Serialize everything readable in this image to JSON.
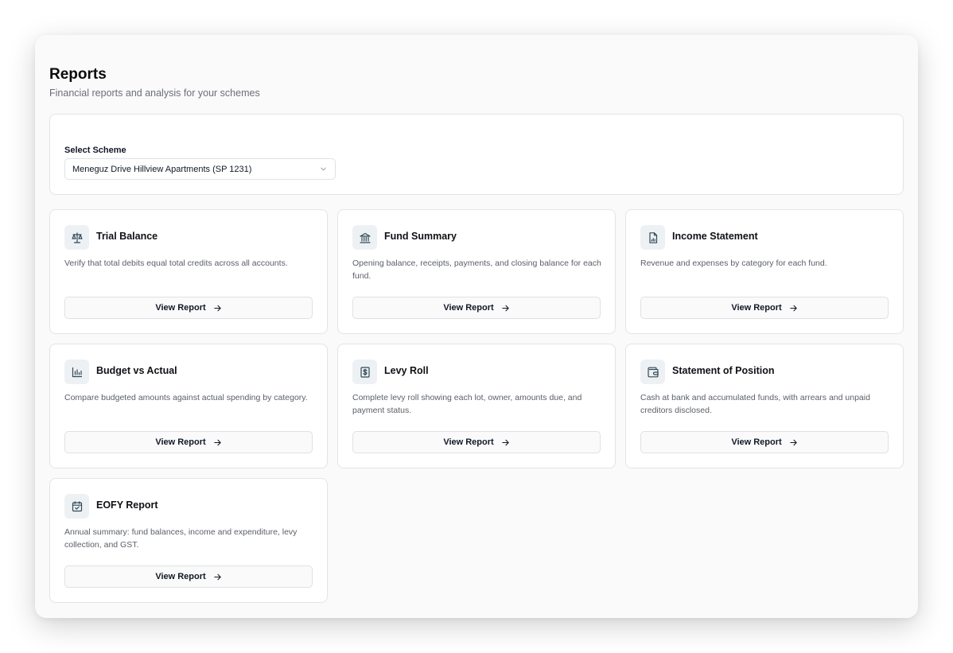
{
  "page": {
    "title": "Reports",
    "subtitle": "Financial reports and analysis for your schemes"
  },
  "scheme": {
    "label": "Select Scheme",
    "selected": "Meneguz Drive Hillview Apartments (SP 1231)"
  },
  "reports": [
    {
      "icon": "scale-icon",
      "title": "Trial Balance",
      "description": "Verify that total debits equal total credits across all accounts.",
      "button": "View Report"
    },
    {
      "icon": "bank-icon",
      "title": "Fund Summary",
      "description": "Opening balance, receipts, payments, and closing balance for each fund.",
      "button": "View Report"
    },
    {
      "icon": "document-chart-icon",
      "title": "Income Statement",
      "description": "Revenue and expenses by category for each fund.",
      "button": "View Report"
    },
    {
      "icon": "bar-chart-icon",
      "title": "Budget vs Actual",
      "description": "Compare budgeted amounts against actual spending by category.",
      "button": "View Report"
    },
    {
      "icon": "dollar-receipt-icon",
      "title": "Levy Roll",
      "description": "Complete levy roll showing each lot, owner, amounts due, and payment status.",
      "button": "View Report"
    },
    {
      "icon": "wallet-icon",
      "title": "Statement of Position",
      "description": "Cash at bank and accumulated funds, with arrears and unpaid creditors disclosed.",
      "button": "View Report"
    },
    {
      "icon": "calendar-check-icon",
      "title": "EOFY Report",
      "description": "Annual summary: fund balances, income and expenditure, levy collection, and GST.",
      "button": "View Report"
    }
  ],
  "colors": {
    "icon_stroke": "#2f4a57",
    "icon_bg": "#eef1f4",
    "card_border": "#e3e4e7"
  }
}
